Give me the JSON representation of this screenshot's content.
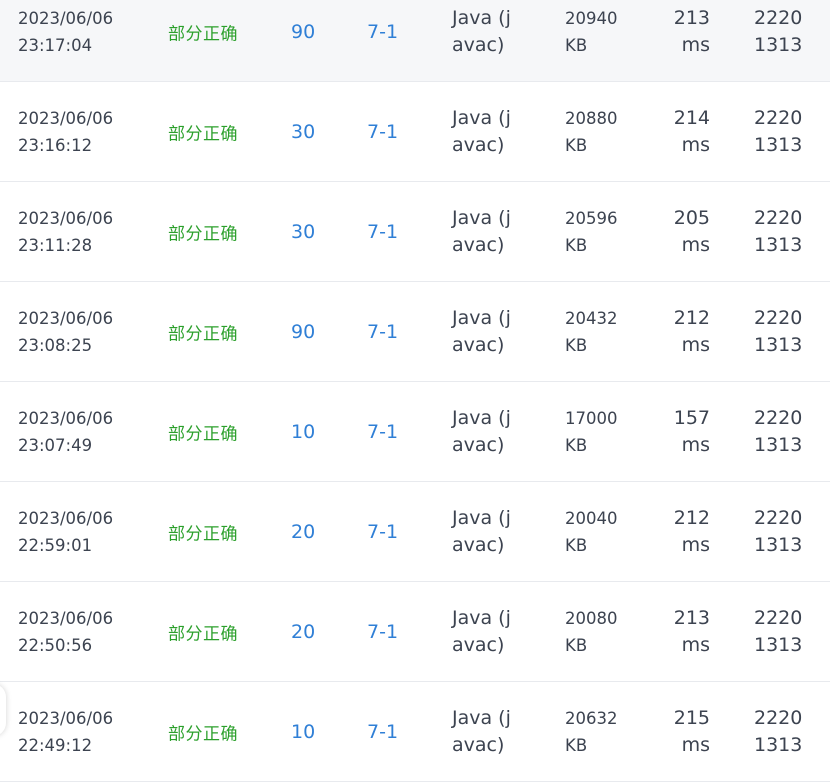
{
  "rows": [
    {
      "date": "2023/06/06",
      "time": "23:17:04",
      "status": "部分正确",
      "score": "90",
      "problem": "7-1",
      "compiler_line1": "Java (j",
      "compiler_line2": "avac)",
      "memory_value": "20940",
      "memory_unit": "KB",
      "runtime_value": "213",
      "runtime_unit": "ms",
      "user_line1": "2220",
      "user_line2": "1313"
    },
    {
      "date": "2023/06/06",
      "time": "23:16:12",
      "status": "部分正确",
      "score": "30",
      "problem": "7-1",
      "compiler_line1": "Java (j",
      "compiler_line2": "avac)",
      "memory_value": "20880",
      "memory_unit": "KB",
      "runtime_value": "214",
      "runtime_unit": "ms",
      "user_line1": "2220",
      "user_line2": "1313"
    },
    {
      "date": "2023/06/06",
      "time": "23:11:28",
      "status": "部分正确",
      "score": "30",
      "problem": "7-1",
      "compiler_line1": "Java (j",
      "compiler_line2": "avac)",
      "memory_value": "20596",
      "memory_unit": "KB",
      "runtime_value": "205",
      "runtime_unit": "ms",
      "user_line1": "2220",
      "user_line2": "1313"
    },
    {
      "date": "2023/06/06",
      "time": "23:08:25",
      "status": "部分正确",
      "score": "90",
      "problem": "7-1",
      "compiler_line1": "Java (j",
      "compiler_line2": "avac)",
      "memory_value": "20432",
      "memory_unit": "KB",
      "runtime_value": "212",
      "runtime_unit": "ms",
      "user_line1": "2220",
      "user_line2": "1313"
    },
    {
      "date": "2023/06/06",
      "time": "23:07:49",
      "status": "部分正确",
      "score": "10",
      "problem": "7-1",
      "compiler_line1": "Java (j",
      "compiler_line2": "avac)",
      "memory_value": "17000",
      "memory_unit": "KB",
      "runtime_value": "157",
      "runtime_unit": "ms",
      "user_line1": "2220",
      "user_line2": "1313"
    },
    {
      "date": "2023/06/06",
      "time": "22:59:01",
      "status": "部分正确",
      "score": "20",
      "problem": "7-1",
      "compiler_line1": "Java (j",
      "compiler_line2": "avac)",
      "memory_value": "20040",
      "memory_unit": "KB",
      "runtime_value": "212",
      "runtime_unit": "ms",
      "user_line1": "2220",
      "user_line2": "1313"
    },
    {
      "date": "2023/06/06",
      "time": "22:50:56",
      "status": "部分正确",
      "score": "20",
      "problem": "7-1",
      "compiler_line1": "Java (j",
      "compiler_line2": "avac)",
      "memory_value": "20080",
      "memory_unit": "KB",
      "runtime_value": "213",
      "runtime_unit": "ms",
      "user_line1": "2220",
      "user_line2": "1313"
    },
    {
      "date": "2023/06/06",
      "time": "22:49:12",
      "status": "部分正确",
      "score": "10",
      "problem": "7-1",
      "compiler_line1": "Java (j",
      "compiler_line2": "avac)",
      "memory_value": "20632",
      "memory_unit": "KB",
      "runtime_value": "215",
      "runtime_unit": "ms",
      "user_line1": "2220",
      "user_line2": "1313"
    }
  ],
  "colors": {
    "status_partial": "#2ca02c",
    "link_blue": "#2f7fd6",
    "text": "#3c4350",
    "row_hover_bg": "#f6f7f9",
    "divider": "#e8eaee"
  }
}
